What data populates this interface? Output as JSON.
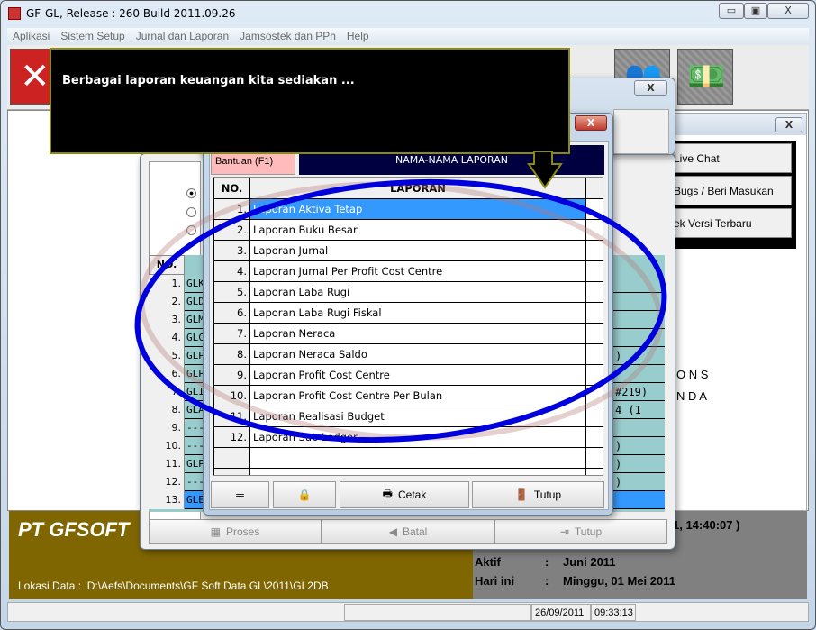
{
  "window": {
    "title": "GF-GL, Release : 260 Build 2011.09.26",
    "min": "▭",
    "max": "▣",
    "close": "X"
  },
  "menu": [
    "Aplikasi",
    "Sistem Setup",
    "Jurnal dan Laporan",
    "Jamsostek dan PPh",
    "Help"
  ],
  "balloon": {
    "text": "Berbagai laporan keuangan kita sediakan ..."
  },
  "support_panel": {
    "close": "X",
    "buttons": [
      "Live Chat",
      "Bugs / Beri Masukan",
      "ek Versi Terbaru"
    ],
    "text1": "O N S",
    "text2": "N D A"
  },
  "back_dialog": {
    "close": "X",
    "no_header": "NO.",
    "rows": [
      {
        "no": "1.",
        "code": "GLK",
        "tail": ""
      },
      {
        "no": "2.",
        "code": "GLD",
        "tail": ""
      },
      {
        "no": "3.",
        "code": "GLM",
        "tail": ""
      },
      {
        "no": "4.",
        "code": "GLC",
        "tail": ""
      },
      {
        "no": "5.",
        "code": "GLP",
        "tail": ")"
      },
      {
        "no": "6.",
        "code": "GLP",
        "tail": ""
      },
      {
        "no": "7.",
        "code": "GLI",
        "tail": "#219)"
      },
      {
        "no": "8.",
        "code": "GLA",
        "tail": "4 (1"
      },
      {
        "no": "9.",
        "code": "---",
        "tail": ""
      },
      {
        "no": "10.",
        "code": "---",
        "tail": ")"
      },
      {
        "no": "11.",
        "code": "GLP",
        "tail": ")"
      },
      {
        "no": "12.",
        "code": "---",
        "tail": ")"
      },
      {
        "no": "13.",
        "code": "GLE",
        "tail": ""
      }
    ],
    "buttons": {
      "proses": "Proses",
      "batal": "Batal",
      "tutup": "Tutup"
    }
  },
  "report_dialog": {
    "close": "X",
    "help_tab": "Bantuan (F1)",
    "header": "NAMA-NAMA LAPORAN",
    "col_no": "NO.",
    "col_laporan": "LAPORAN",
    "rows": [
      {
        "no": "1.",
        "name": "Laporan Aktiva Tetap"
      },
      {
        "no": "2.",
        "name": "Laporan Buku Besar"
      },
      {
        "no": "3.",
        "name": "Laporan Jurnal"
      },
      {
        "no": "4.",
        "name": "Laporan Jurnal Per Profit Cost Centre"
      },
      {
        "no": "5.",
        "name": "Laporan Laba Rugi"
      },
      {
        "no": "6.",
        "name": "Laporan Laba Rugi Fiskal"
      },
      {
        "no": "7.",
        "name": "Laporan Neraca"
      },
      {
        "no": "8.",
        "name": "Laporan Neraca Saldo"
      },
      {
        "no": "9.",
        "name": "Laporan Profit Cost Centre"
      },
      {
        "no": "10.",
        "name": "Laporan Profit Cost Centre Per Bulan"
      },
      {
        "no": "11.",
        "name": "Laporan Realisasi Budget"
      },
      {
        "no": "12.",
        "name": "Laporan Sub Ledger"
      }
    ],
    "selected_row": 1,
    "buttons": {
      "menu": "═",
      "cetak": "Cetak",
      "tutup": "Tutup"
    }
  },
  "footer": {
    "company": "PT GFSOFT",
    "lokasi_label": "Lokasi Data :",
    "lokasi_value": "D:\\Aefs\\Documents\\GF Soft Data GL\\2011\\GL2DB",
    "time_fragment": "1, 14:40:07 )",
    "aktif_label": "Aktif",
    "aktif_value": "Juni 2011",
    "hari_label": "Hari ini",
    "hari_value": "Minggu, 01 Mei 2011",
    "sep": ":"
  },
  "statusbar": {
    "date": "26/09/2011",
    "time": "09:33:13"
  },
  "colors": {
    "olive": "#806600",
    "grey": "#808080",
    "selection": "#3399ff",
    "teal": "#99cccc",
    "navy": "#000040",
    "ellipse": "#0000dd"
  }
}
